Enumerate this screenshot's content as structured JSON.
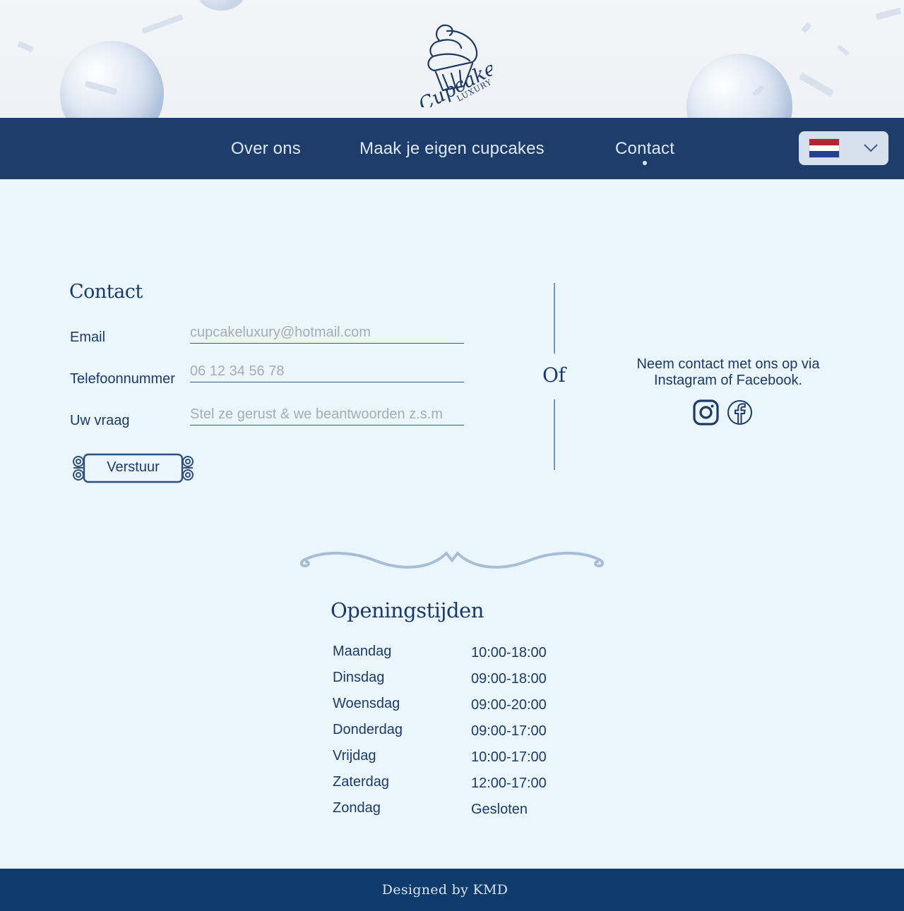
{
  "brand": {
    "logo_script": "Cupcake",
    "logo_sub": "LUXURY"
  },
  "nav": {
    "items": [
      {
        "label": "Over ons"
      },
      {
        "label": "Maak je eigen cupcakes"
      },
      {
        "label": "Contact",
        "active": true
      }
    ],
    "language_flag": "flag-nl-icon"
  },
  "contact": {
    "title": "Contact",
    "fields": [
      {
        "label": "Email",
        "placeholder": "cupcakeluxury@hotmail.com"
      },
      {
        "label": "Telefoonnummer",
        "placeholder": "06 12 34 56 78"
      },
      {
        "label": "Uw vraag",
        "placeholder": "Stel ze gerust & we beantwoorden z.s.m"
      }
    ],
    "submit_label": "Verstuur",
    "divider_text": "Of",
    "social_text": "Neem contact met ons op via Instagram of Facebook."
  },
  "hours": {
    "title": "Openingstijden",
    "rows": [
      {
        "day": "Maandag",
        "time": "10:00-18:00"
      },
      {
        "day": "Dinsdag",
        "time": "09:00-18:00"
      },
      {
        "day": "Woensdag",
        "time": "09:00-20:00"
      },
      {
        "day": "Donderdag",
        "time": "09:00-17:00"
      },
      {
        "day": "Vrijdag",
        "time": "10:00-17:00"
      },
      {
        "day": "Zaterdag",
        "time": "12:00-17:00"
      },
      {
        "day": "Zondag",
        "time": "Gesloten"
      }
    ]
  },
  "footer": {
    "text": "Designed by KMD"
  },
  "colors": {
    "nav_bg": "#1e3d6b",
    "page_bg": "#eaf5fc",
    "text": "#1d3a66",
    "footer_bg": "#0f3b6c"
  }
}
